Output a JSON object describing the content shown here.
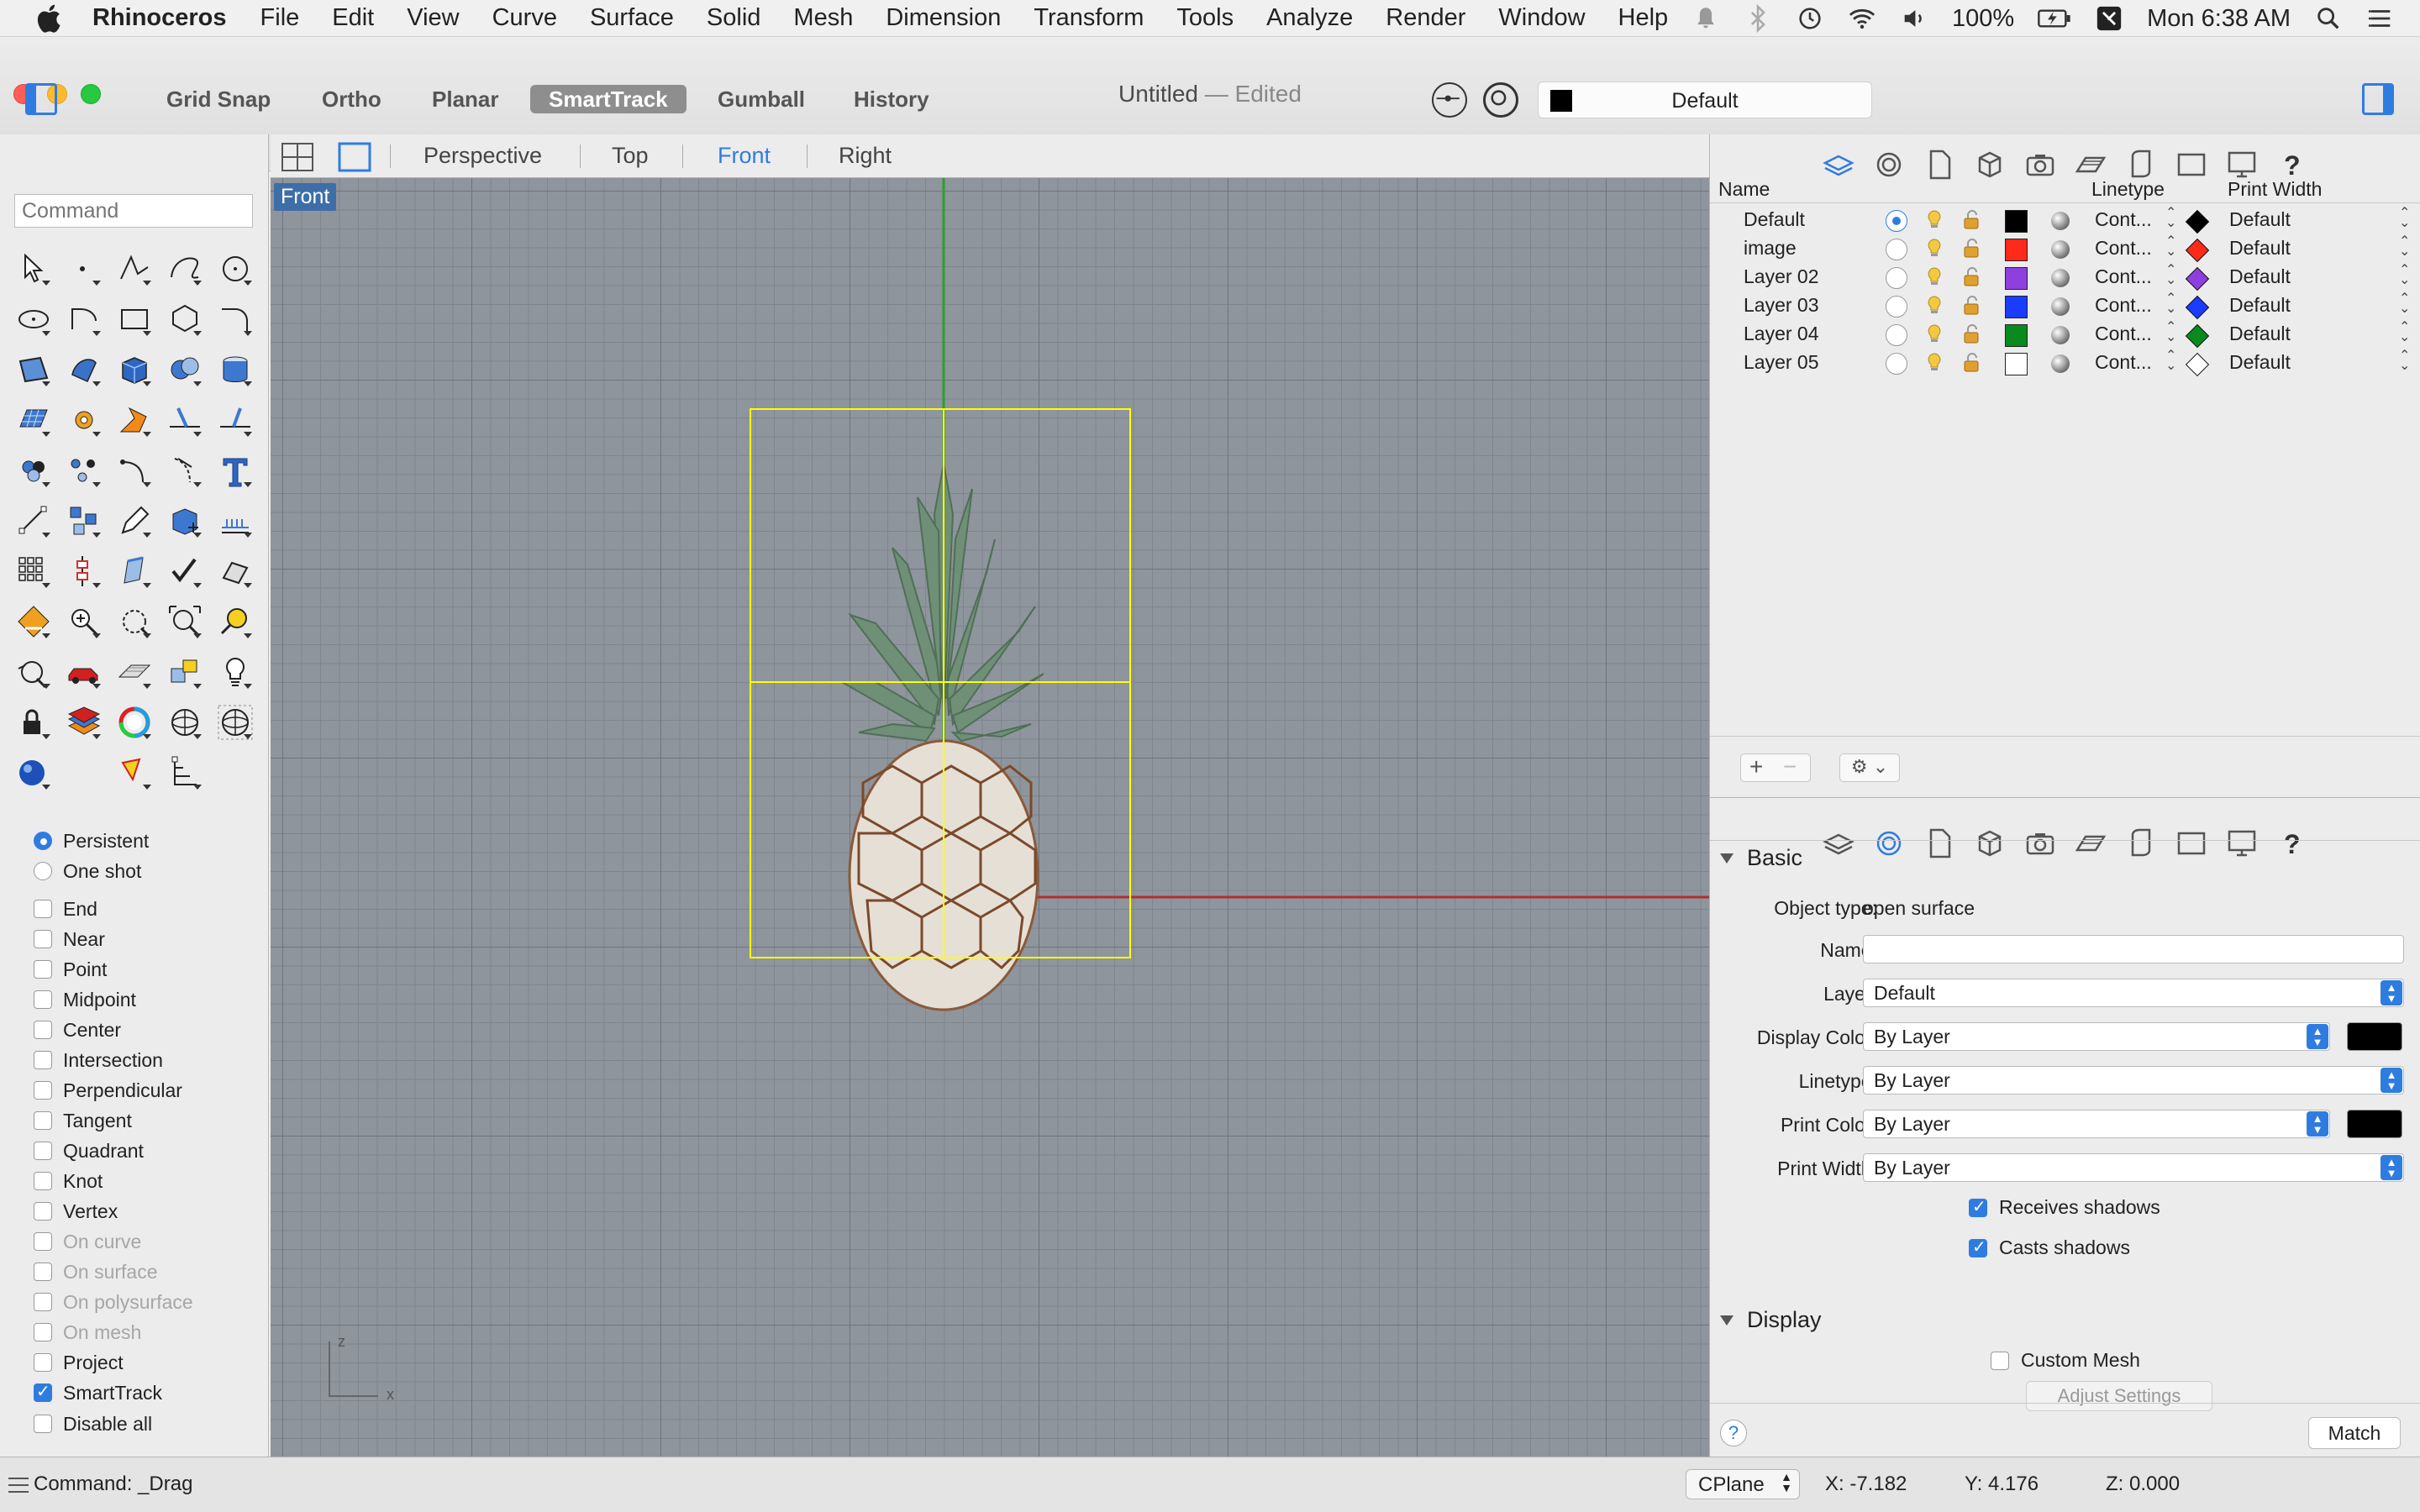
{
  "menubar": {
    "app_name": "Rhinoceros",
    "menus": [
      "File",
      "Edit",
      "View",
      "Curve",
      "Surface",
      "Solid",
      "Mesh",
      "Dimension",
      "Transform",
      "Tools",
      "Analyze",
      "Render",
      "Window",
      "Help"
    ],
    "battery": "100%",
    "clock": "Mon 6:38 AM"
  },
  "window": {
    "title": "Untitled",
    "title_suffix": "— Edited"
  },
  "toolbar": {
    "modes": [
      {
        "label": "Grid Snap",
        "active": false
      },
      {
        "label": "Ortho",
        "active": false
      },
      {
        "label": "Planar",
        "active": false
      },
      {
        "label": "SmartTrack",
        "active": true
      },
      {
        "label": "Gumball",
        "active": false
      },
      {
        "label": "History",
        "active": false
      }
    ],
    "current_layer": "Default"
  },
  "command": {
    "placeholder": "Command"
  },
  "osnaps": {
    "mode": [
      {
        "label": "Persistent",
        "checked": true
      },
      {
        "label": "One shot",
        "checked": false
      }
    ],
    "items": [
      {
        "label": "End",
        "checked": false,
        "enabled": true
      },
      {
        "label": "Near",
        "checked": false,
        "enabled": true
      },
      {
        "label": "Point",
        "checked": false,
        "enabled": true
      },
      {
        "label": "Midpoint",
        "checked": false,
        "enabled": true
      },
      {
        "label": "Center",
        "checked": false,
        "enabled": true
      },
      {
        "label": "Intersection",
        "checked": false,
        "enabled": true
      },
      {
        "label": "Perpendicular",
        "checked": false,
        "enabled": true
      },
      {
        "label": "Tangent",
        "checked": false,
        "enabled": true
      },
      {
        "label": "Quadrant",
        "checked": false,
        "enabled": true
      },
      {
        "label": "Knot",
        "checked": false,
        "enabled": true
      },
      {
        "label": "Vertex",
        "checked": false,
        "enabled": true
      },
      {
        "label": "On curve",
        "checked": false,
        "enabled": false
      },
      {
        "label": "On surface",
        "checked": false,
        "enabled": false
      },
      {
        "label": "On polysurface",
        "checked": false,
        "enabled": false
      },
      {
        "label": "On mesh",
        "checked": false,
        "enabled": false
      },
      {
        "label": "Project",
        "checked": false,
        "enabled": true
      },
      {
        "label": "SmartTrack",
        "checked": true,
        "enabled": true
      }
    ],
    "disable_all": "Disable all"
  },
  "viewport": {
    "tabs": [
      {
        "label": "Perspective",
        "active": false
      },
      {
        "label": "Top",
        "active": false
      },
      {
        "label": "Front",
        "active": true
      },
      {
        "label": "Right",
        "active": false
      }
    ],
    "label": "Front",
    "axis_z": "z",
    "axis_x": "x"
  },
  "layers": {
    "headers": {
      "name": "Name",
      "linetype": "Linetype",
      "print_width": "Print Width"
    },
    "rows": [
      {
        "name": "Default",
        "current": true,
        "color": "#000000",
        "linetype": "Cont...",
        "print_color": "#000000",
        "print_width": "Default"
      },
      {
        "name": "image",
        "current": false,
        "color": "#ff2a1a",
        "linetype": "Cont...",
        "print_color": "#ff2a1a",
        "print_width": "Default"
      },
      {
        "name": "Layer 02",
        "current": false,
        "color": "#8f3fe0",
        "linetype": "Cont...",
        "print_color": "#8f3fe0",
        "print_width": "Default"
      },
      {
        "name": "Layer 03",
        "current": false,
        "color": "#1a3cff",
        "linetype": "Cont...",
        "print_color": "#1a3cff",
        "print_width": "Default"
      },
      {
        "name": "Layer 04",
        "current": false,
        "color": "#0a8a1e",
        "linetype": "Cont...",
        "print_color": "#0a8a1e",
        "print_width": "Default"
      },
      {
        "name": "Layer 05",
        "current": false,
        "color": "#ffffff",
        "linetype": "Cont...",
        "print_color": "#ffffff",
        "print_width": "Default"
      }
    ]
  },
  "properties": {
    "basic_title": "Basic",
    "object_type_label": "Object type:",
    "object_type": "open surface",
    "name_label": "Name:",
    "name_value": "",
    "layer_label": "Layer:",
    "layer_value": "Default",
    "display_color_label": "Display Color:",
    "display_color_value": "By Layer",
    "linetype_label": "Linetype:",
    "linetype_value": "By Layer",
    "print_color_label": "Print Color:",
    "print_color_value": "By Layer",
    "print_width_label": "Print Width:",
    "print_width_value": "By Layer",
    "receives_shadows": "Receives shadows",
    "casts_shadows": "Casts shadows",
    "display_title": "Display",
    "custom_mesh": "Custom Mesh",
    "adjust_settings": "Adjust Settings",
    "help": "?",
    "match": "Match"
  },
  "statusbar": {
    "command": "Command: _Drag",
    "cplane": "CPlane",
    "x": "X: -7.182",
    "y": "Y: 4.176",
    "z": "Z: 0.000"
  },
  "colors": {
    "accent": "#2f7ce0",
    "viewport_bg": "#8f959c",
    "x_axis": "#b03030",
    "y_axis": "#2aa02a",
    "selection": "#ffff00"
  }
}
